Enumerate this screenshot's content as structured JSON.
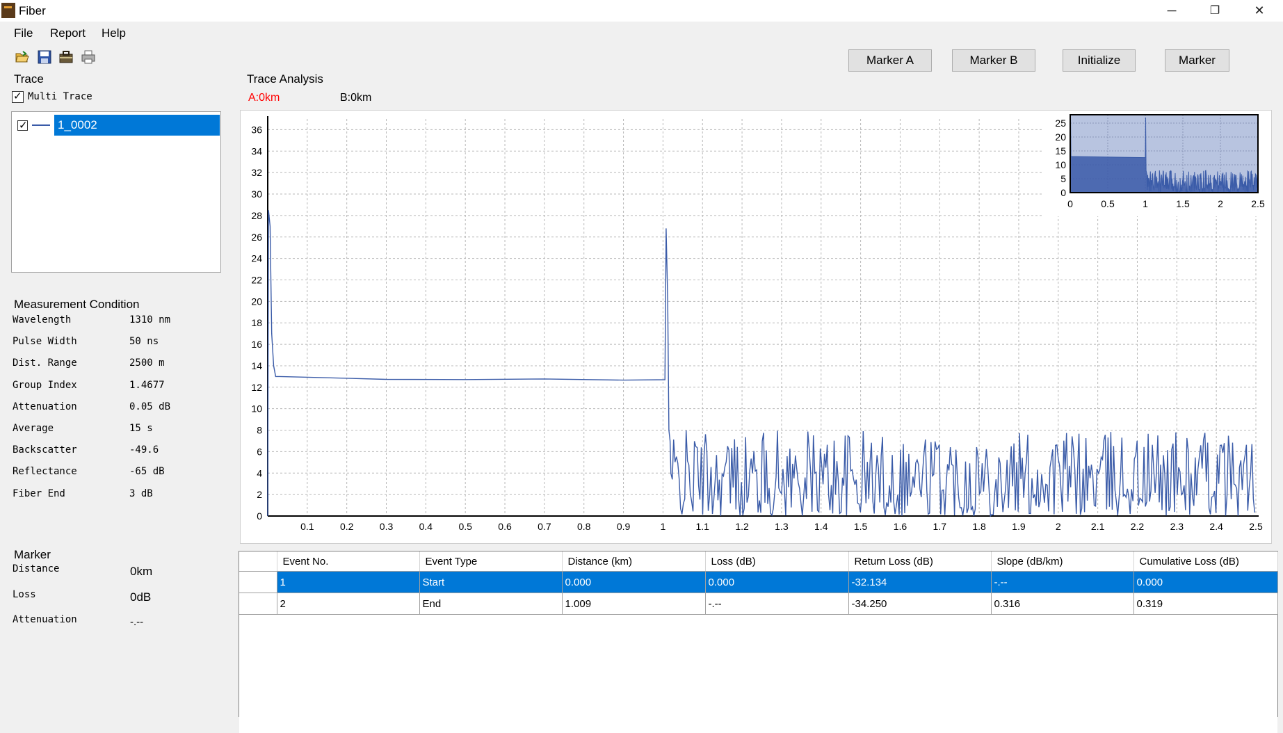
{
  "window": {
    "title": "Fiber",
    "minimize": "─",
    "restore": "❐",
    "close": "✕"
  },
  "menu": [
    "File",
    "Report",
    "Help"
  ],
  "toolbar": [
    "open-folder-icon",
    "save-disk-icon",
    "briefcase-icon",
    "print-icon"
  ],
  "buttons": {
    "marker_a": "Marker A",
    "marker_b": "Marker B",
    "initialize": "Initialize",
    "marker": "Marker"
  },
  "trace": {
    "caption": "Trace",
    "multi_trace_label": "Multi Trace",
    "multi_trace_checked": true,
    "items": [
      {
        "name": "1_0002",
        "checked": true,
        "selected": true
      }
    ]
  },
  "measurement": {
    "caption": "Measurement Condition",
    "rows": [
      {
        "label": "Wavelength",
        "value": "1310 nm"
      },
      {
        "label": "Pulse Width",
        "value": "50 ns"
      },
      {
        "label": "Dist. Range",
        "value": "2500 m"
      },
      {
        "label": "Group Index",
        "value": "1.4677"
      },
      {
        "label": "Attenuation",
        "value": "0.05 dB"
      },
      {
        "label": "Average",
        "value": "15 s"
      },
      {
        "label": "Backscatter",
        "value": "-49.6"
      },
      {
        "label": "Reflectance",
        "value": "-65 dB"
      },
      {
        "label": "Fiber End",
        "value": "3 dB"
      }
    ]
  },
  "marker": {
    "caption": "Marker",
    "rows": [
      {
        "label": "Distance",
        "value": "0km"
      },
      {
        "label": "Loss",
        "value": "0dB"
      },
      {
        "label": "Attenuation",
        "value": "-.--"
      }
    ]
  },
  "analysis": {
    "caption": "Trace Analysis",
    "marker_a_readout": "A:0km",
    "marker_b_readout": "B:0km",
    "marker_a_color": "#ff0000"
  },
  "colors": {
    "trace": "#3a5ba8",
    "selection": "#0078d7",
    "overview_fill": "#b8c4e0"
  },
  "chart_data": [
    {
      "type": "line",
      "xlim": [
        0,
        2.5
      ],
      "ylim": [
        0,
        37
      ],
      "x_ticks": [
        "0.1",
        "0.2",
        "0.3",
        "0.4",
        "0.5",
        "0.6",
        "0.7",
        "0.8",
        "0.9",
        "1",
        "1.1",
        "1.2",
        "1.3",
        "1.4",
        "1.5",
        "1.6",
        "1.7",
        "1.8",
        "1.9",
        "2",
        "2.1",
        "2.2",
        "2.3",
        "2.4",
        "2.5"
      ],
      "y_ticks": [
        "0",
        "2",
        "4",
        "6",
        "8",
        "10",
        "12",
        "14",
        "16",
        "18",
        "20",
        "22",
        "24",
        "26",
        "28",
        "30",
        "32",
        "34",
        "36"
      ],
      "grid": true,
      "series": [
        {
          "x": [
            0,
            0.002,
            0.006,
            0.01,
            0.015,
            0.02,
            0.03,
            0.1,
            0.3,
            0.5,
            0.7,
            0.9,
            1.005,
            1.008,
            1.012,
            1.015,
            1.018,
            1.022,
            1.03,
            1.1,
            1.5,
            2.0,
            2.5
          ],
          "y": [
            0,
            28.5,
            27,
            17,
            14,
            13,
            13,
            12.9,
            12.8,
            12.7,
            12.6,
            12.6,
            12.7,
            26.8,
            20,
            8,
            7,
            4,
            3,
            3,
            3,
            3,
            3
          ],
          "noise_from_x": 1.02,
          "noise_range": [
            0,
            8
          ]
        }
      ]
    },
    {
      "type": "area",
      "xlim": [
        0,
        2.5
      ],
      "ylim": [
        0,
        28
      ],
      "x_ticks": [
        "0",
        "0.5",
        "1",
        "1.5",
        "2",
        "2.5"
      ],
      "y_ticks": [
        "0",
        "5",
        "10",
        "15",
        "20",
        "25"
      ],
      "grid": true,
      "series": [
        {
          "x": [
            0,
            0.005,
            0.01,
            1.0,
            1.005,
            1.01,
            1.02,
            2.5
          ],
          "y": [
            0,
            28,
            13,
            12.6,
            27,
            8,
            3,
            3
          ],
          "noise_from_x": 1.02,
          "noise_range": [
            0,
            8
          ]
        }
      ]
    }
  ],
  "events": {
    "columns": [
      "Event No.",
      "Event Type",
      "Distance (km)",
      "Loss (dB)",
      "Return Loss (dB)",
      "Slope (dB/km)",
      "Cumulative Loss (dB)"
    ],
    "rows": [
      {
        "selected": true,
        "indicator": "▶",
        "cells": [
          "1",
          "Start",
          "0.000",
          "0.000",
          "-32.134",
          "-.--",
          "0.000"
        ]
      },
      {
        "selected": false,
        "indicator": "",
        "cells": [
          "2",
          "End",
          "1.009",
          "-.--",
          "-34.250",
          "0.316",
          "0.319"
        ]
      }
    ]
  }
}
